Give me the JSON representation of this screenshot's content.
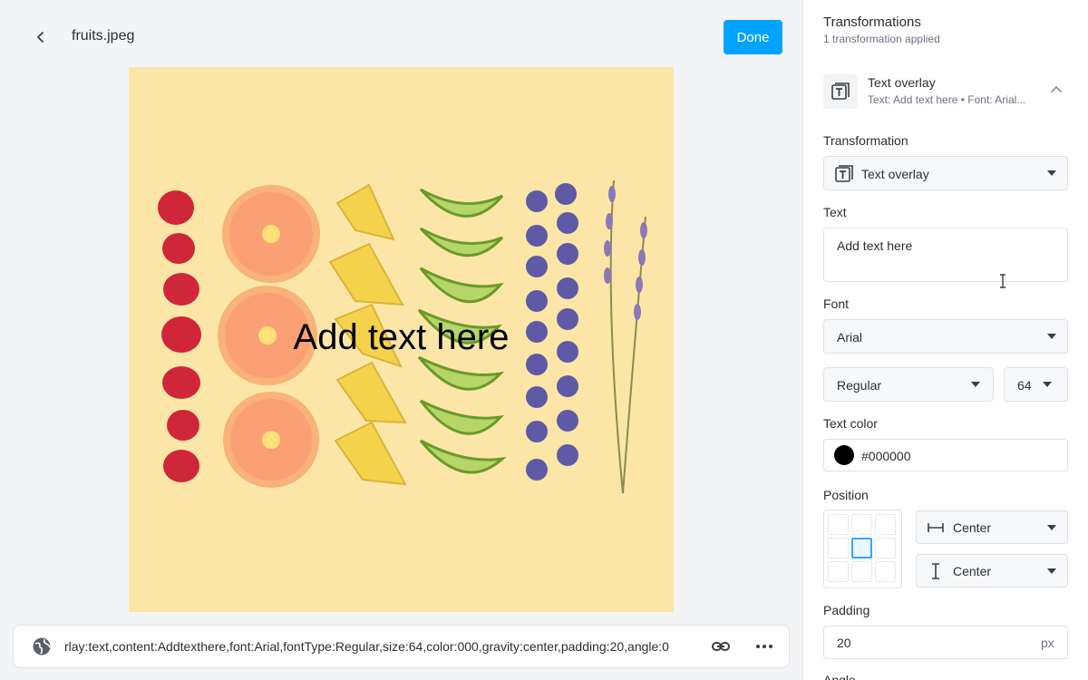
{
  "header": {
    "file_name": "fruits.jpeg",
    "done_label": "Done"
  },
  "canvas": {
    "overlay_text": "Add text here",
    "background_color": "#fce6a7"
  },
  "url_bar": {
    "transformation_string": "tr:l-text,overlay:text,content:Addtexthere,font:Arial,fontType:Regular,size:64,color:000,gravity:center,padding:20,angle:0",
    "visible_text": "rlay:text,content:Addtexthere,font:Arial,fontType:Regular,size:64,color:000,gravity:center,padding:20,angle:0"
  },
  "panel": {
    "title": "Transformations",
    "subtitle": "1 transformation applied",
    "card": {
      "name": "Text overlay",
      "desc": "Text: Add text here • Font: Arial..."
    },
    "transformation_label": "Transformation",
    "transformation_value": "Text overlay",
    "text_label": "Text",
    "text_value": "Add text here",
    "font_label": "Font",
    "font_value": "Arial",
    "font_type_value": "Regular",
    "font_size_value": "64",
    "text_color_label": "Text color",
    "text_color_value": "#000000",
    "position_label": "Position",
    "horizontal_value": "Center",
    "vertical_value": "Center",
    "padding_label": "Padding",
    "padding_value": "20",
    "padding_unit": "px",
    "angle_label": "Angle"
  },
  "colors": {
    "accent": "#00a3ff",
    "selected_cell": "#33a6ff",
    "swatch": "#000000"
  }
}
